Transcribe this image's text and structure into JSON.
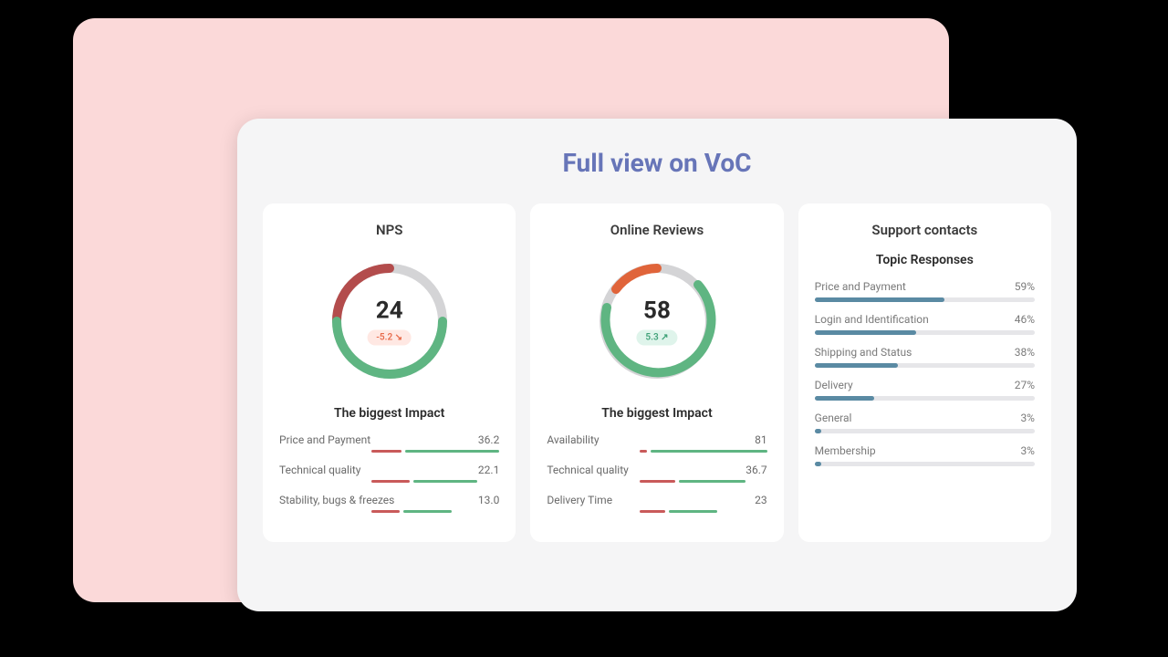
{
  "title": "Full view on VoC",
  "nps": {
    "title": "NPS",
    "value": "24",
    "delta": "-5.2  ↘",
    "delta_dir": "neg",
    "section": "The biggest Impact",
    "items": [
      {
        "label": "Price and Payment",
        "value": "36.2",
        "neg": 24,
        "pos": 76
      },
      {
        "label": "Technical quality",
        "value": "22.1",
        "neg": 30,
        "pos": 50
      },
      {
        "label": "Stability, bugs & freezes",
        "value": "13.0",
        "neg": 22,
        "pos": 38
      }
    ]
  },
  "reviews": {
    "title": "Online Reviews",
    "value": "58",
    "delta": "5.3  ↗",
    "delta_dir": "pos",
    "section": "The biggest Impact",
    "items": [
      {
        "label": "Availability",
        "value": "81",
        "neg": 6,
        "pos": 94
      },
      {
        "label": "Technical quality",
        "value": "36.7",
        "neg": 28,
        "pos": 52
      },
      {
        "label": "Delivery Time",
        "value": "23",
        "neg": 20,
        "pos": 38
      }
    ]
  },
  "support": {
    "title": "Support contacts",
    "section": "Topic Responses",
    "topics": [
      {
        "label": "Price and Payment",
        "pct": 59
      },
      {
        "label": "Login and Identification",
        "pct": 46
      },
      {
        "label": "Shipping and Status",
        "pct": 38
      },
      {
        "label": "Delivery",
        "pct": 27
      },
      {
        "label": "General",
        "pct": 3
      },
      {
        "label": "Membership",
        "pct": 3
      }
    ]
  },
  "chart_data": [
    {
      "type": "gauge",
      "title": "NPS",
      "value": 24,
      "delta": -5.2,
      "segments": [
        {
          "name": "red",
          "start": 0,
          "end": 90,
          "color": "#b34c4c"
        },
        {
          "name": "grey",
          "start": 90,
          "end": 180,
          "color": "#d4d4d6"
        },
        {
          "name": "green",
          "start": 180,
          "end": 360,
          "color": "#5fb582"
        }
      ],
      "impacts": [
        {
          "category": "Price and Payment",
          "value": 36.2
        },
        {
          "category": "Technical quality",
          "value": 22.1
        },
        {
          "category": "Stability, bugs & freezes",
          "value": 13.0
        }
      ]
    },
    {
      "type": "gauge",
      "title": "Online Reviews",
      "value": 58,
      "delta": 5.3,
      "segments": [
        {
          "name": "orange",
          "start": 0,
          "end": 60,
          "color": "#e0643a"
        },
        {
          "name": "grey",
          "start": 60,
          "end": 120,
          "color": "#d4d4d6"
        },
        {
          "name": "green",
          "start": 120,
          "end": 360,
          "color": "#5fb582"
        }
      ],
      "impacts": [
        {
          "category": "Availability",
          "value": 81
        },
        {
          "category": "Technical quality",
          "value": 36.7
        },
        {
          "category": "Delivery Time",
          "value": 23
        }
      ]
    },
    {
      "type": "bar",
      "title": "Support contacts — Topic Responses",
      "categories": [
        "Price and Payment",
        "Login and Identification",
        "Shipping and Status",
        "Delivery",
        "General",
        "Membership"
      ],
      "values": [
        59,
        46,
        38,
        27,
        3,
        3
      ],
      "xlabel": "",
      "ylabel": "%",
      "ylim": [
        0,
        100
      ]
    }
  ]
}
